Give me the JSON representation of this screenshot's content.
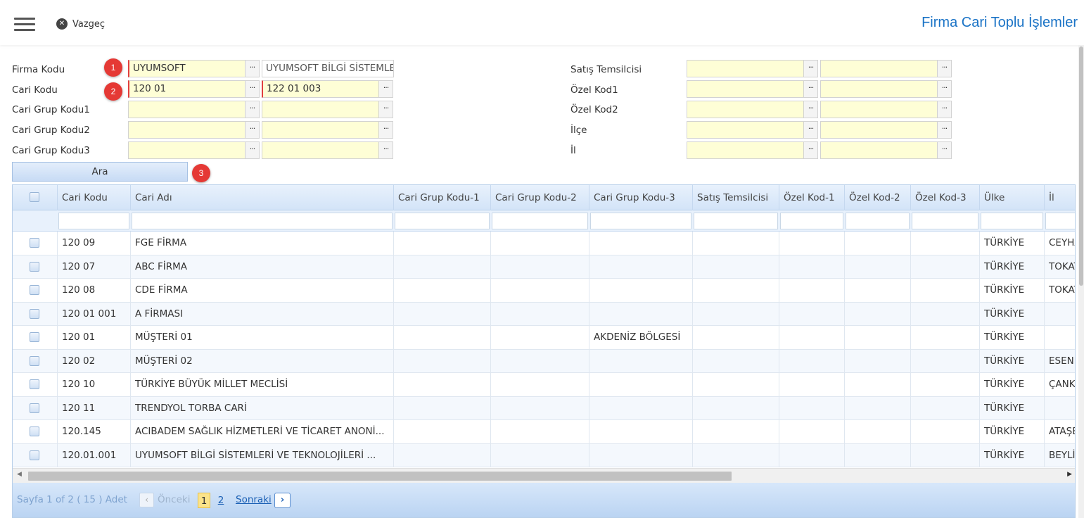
{
  "header": {
    "menu_icon": "hamburger-menu-icon",
    "cancel_label": "Vazgeç",
    "cancel_icon": "close-circle-icon",
    "title": "Firma Cari Toplu İşlemler",
    "title_color": "#1a73c6"
  },
  "form": {
    "firma_kodu": {
      "label": "Firma Kodu",
      "value": "UYUMSOFT",
      "desc": "UYUMSOFT BİLGİ SİSTEMLERİ"
    },
    "cari_kodu": {
      "label": "Cari Kodu",
      "from": "120 01",
      "to": "122 01 003"
    },
    "cari_grup_1": {
      "label": "Cari Grup Kodu1"
    },
    "cari_grup_2": {
      "label": "Cari Grup Kodu2"
    },
    "cari_grup_3": {
      "label": "Cari Grup Kodu3"
    },
    "satis_temsilcisi": {
      "label": "Satış Temsilcisi"
    },
    "ozel_kod1": {
      "label": "Özel Kod1"
    },
    "ozel_kod2": {
      "label": "Özel Kod2"
    },
    "ilce": {
      "label": "İlçe"
    },
    "il": {
      "label": "İl"
    },
    "dots_label": "···",
    "search_button": "Ara",
    "badges": [
      "1",
      "2",
      "3"
    ],
    "badge_color": "#e53935",
    "required_color": "#e04040",
    "input_bg": "#fefed6"
  },
  "grid": {
    "columns": [
      "",
      "Cari Kodu",
      "Cari Adı",
      "Cari Grup Kodu-1",
      "Cari Grup Kodu-2",
      "Cari Grup Kodu-3",
      "Satış Temsilcisi",
      "Özel Kod-1",
      "Özel Kod-2",
      "Özel Kod-3",
      "Ülke",
      "İl"
    ],
    "rows": [
      [
        "120 09",
        "FGE FİRMA",
        "",
        "",
        "",
        "",
        "",
        "",
        "",
        "TÜRKİYE",
        "CEYHAN"
      ],
      [
        "120 07",
        "ABC FİRMA",
        "",
        "",
        "",
        "",
        "",
        "",
        "",
        "TÜRKİYE",
        "TOKAT"
      ],
      [
        "120 08",
        "CDE FİRMA",
        "",
        "",
        "",
        "",
        "",
        "",
        "",
        "TÜRKİYE",
        "TOKAT"
      ],
      [
        "120 01 001",
        "A FİRMASI",
        "",
        "",
        "",
        "",
        "",
        "",
        "",
        "TÜRKİYE",
        ""
      ],
      [
        "120 01",
        "MÜŞTERİ 01",
        "",
        "",
        "AKDENİZ BÖLGESİ",
        "",
        "",
        "",
        "",
        "TÜRKİYE",
        ""
      ],
      [
        "120 02",
        "MÜŞTERİ 02",
        "",
        "",
        "",
        "",
        "",
        "",
        "",
        "TÜRKİYE",
        "ESENLER"
      ],
      [
        "120 10",
        "TÜRKİYE BÜYÜK MİLLET MECLİSİ",
        "",
        "",
        "",
        "",
        "",
        "",
        "",
        "TÜRKİYE",
        "ÇANKAYA"
      ],
      [
        "120 11",
        "TRENDYOL TORBA CARİ",
        "",
        "",
        "",
        "",
        "",
        "",
        "",
        "TÜRKİYE",
        ""
      ],
      [
        "120.145",
        "ACIBADEM SAĞLIK HİZMETLERİ VE TİCARET ANONİ...",
        "",
        "",
        "",
        "",
        "",
        "",
        "",
        "TÜRKİYE",
        "ATAŞEHİR"
      ],
      [
        "120.01.001",
        "UYUMSOFT BİLGİ SİSTEMLERİ VE TEKNOLOJİLERİ ...",
        "",
        "",
        "",
        "",
        "",
        "",
        "",
        "TÜRKİYE",
        "BEYLİKDÜZÜ"
      ]
    ]
  },
  "pager": {
    "info": "Sayfa 1 of 2 ( 15 ) Adet",
    "prev": "Önceki",
    "page1": "1",
    "page2": "2",
    "next": "Sonraki",
    "prev_icon": "chevron-left-icon",
    "next_icon": "chevron-right-icon"
  }
}
